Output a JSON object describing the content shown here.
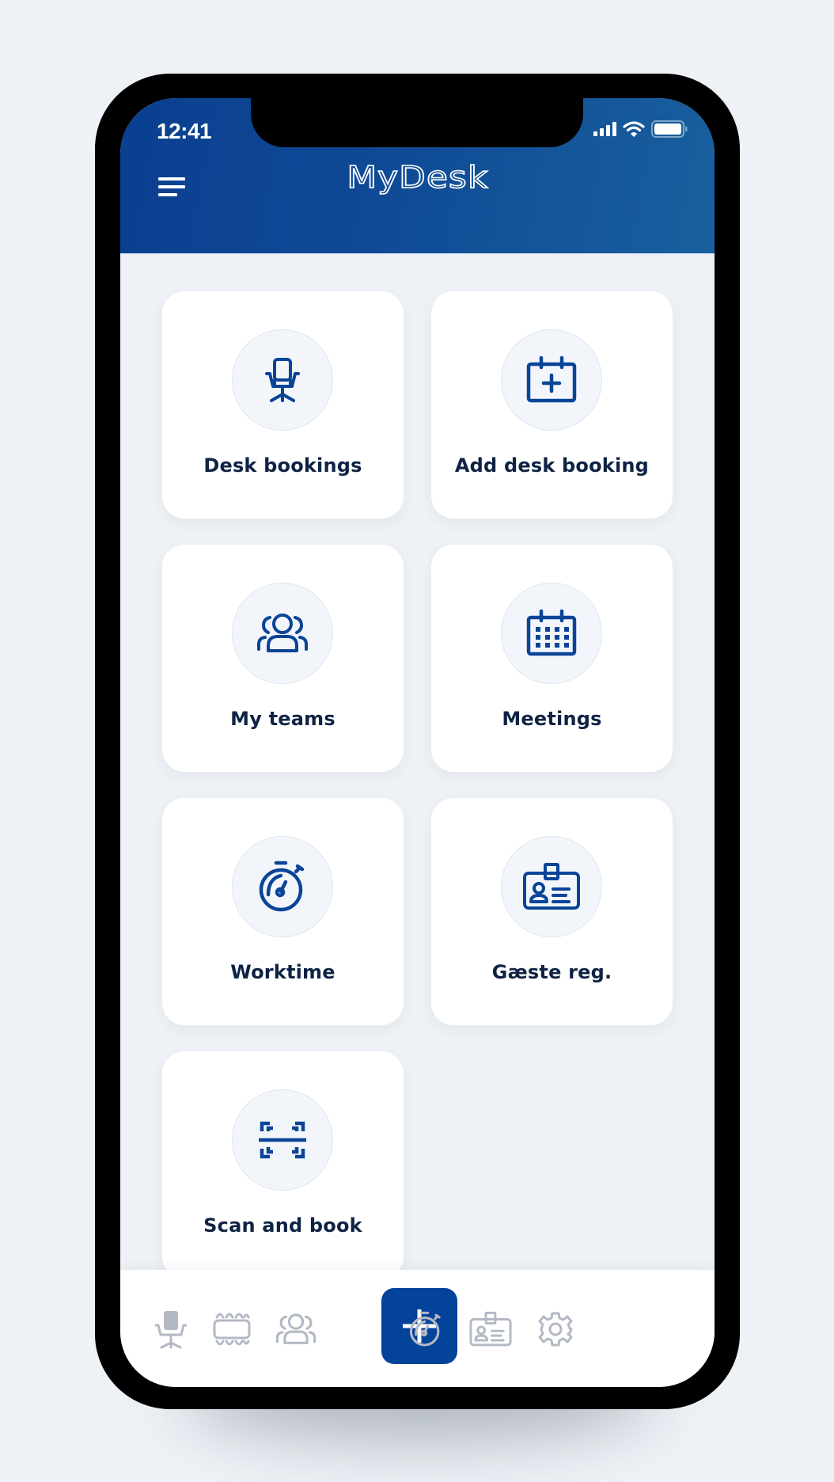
{
  "status_bar": {
    "time": "12:41",
    "icons": [
      "signal-icon",
      "wifi-icon",
      "battery-icon"
    ]
  },
  "header": {
    "app_title": "MyDesk",
    "menu_icon": "hamburger-menu-icon"
  },
  "colors": {
    "brand": "#04439a",
    "header_start": "#0a3f8f",
    "header_end": "#18609e",
    "text": "#0f2344",
    "nav_inactive": "#b3b9c4"
  },
  "tiles": [
    {
      "label": "Desk bookings",
      "icon": "office-chair-icon"
    },
    {
      "label": "Add desk booking",
      "icon": "calendar-plus-icon"
    },
    {
      "label": "My teams",
      "icon": "team-icon"
    },
    {
      "label": "Meetings",
      "icon": "calendar-grid-icon"
    },
    {
      "label": "Worktime",
      "icon": "stopwatch-icon"
    },
    {
      "label": "Gæste reg.",
      "icon": "id-badge-icon"
    },
    {
      "label": "Scan and book",
      "icon": "scan-icon"
    }
  ],
  "bottom_nav": {
    "items": [
      {
        "icon": "office-chair-icon",
        "target": "Desk bookings"
      },
      {
        "icon": "meeting-table-icon",
        "target": "Meetings"
      },
      {
        "icon": "team-icon",
        "target": "My teams"
      },
      {
        "icon": "plus-icon",
        "target": "Add"
      },
      {
        "icon": "stopwatch-icon",
        "target": "Worktime"
      },
      {
        "icon": "id-badge-icon",
        "target": "Gæste reg."
      },
      {
        "icon": "gear-icon",
        "target": "Settings"
      }
    ]
  }
}
